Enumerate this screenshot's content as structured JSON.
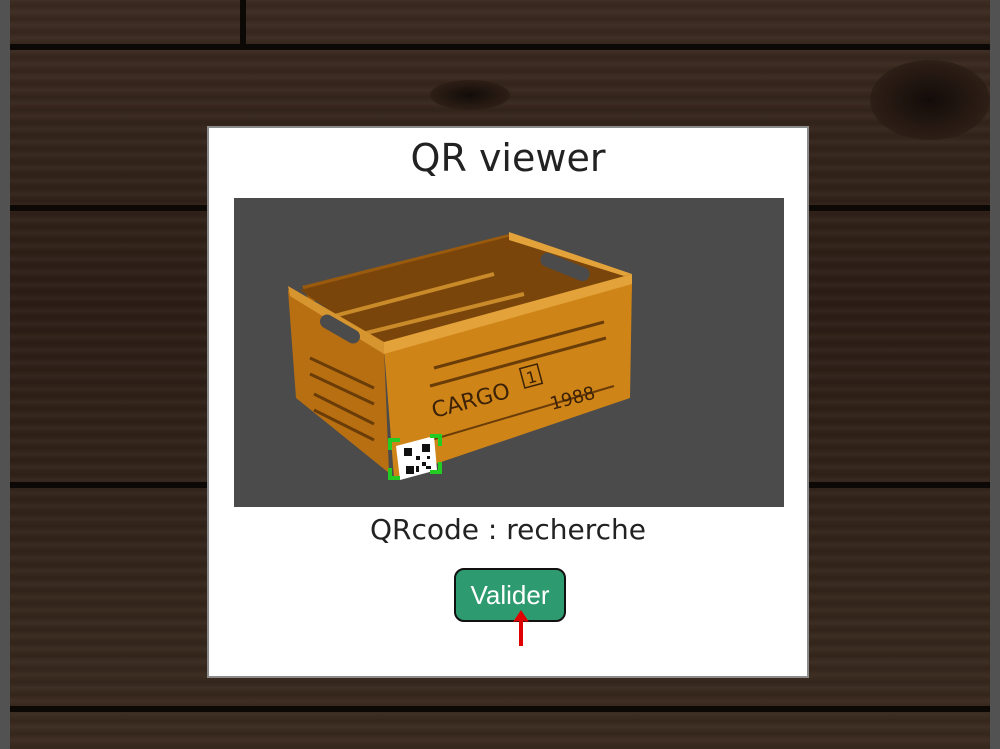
{
  "window": {
    "title": "QR viewer"
  },
  "viewer": {
    "image_subject": "wooden crate",
    "crate_text_main": "CARGO",
    "crate_text_number": "1",
    "crate_text_year": "1988",
    "detection_color": "#22cc22"
  },
  "status": {
    "text": "QRcode : recherche"
  },
  "actions": {
    "validate_label": "Valider"
  },
  "colors": {
    "button": "#2e9a6f",
    "pointer": "#e10000"
  }
}
